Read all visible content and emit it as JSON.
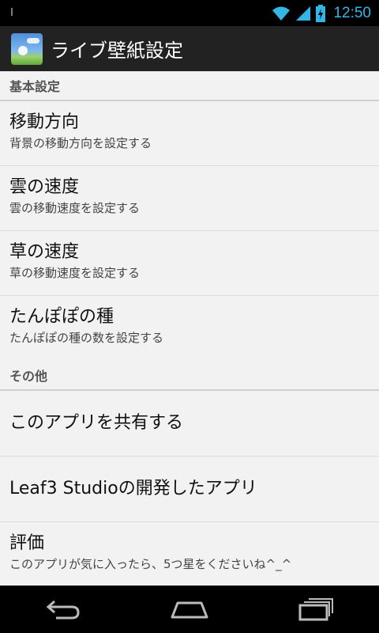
{
  "status_bar": {
    "time": "12:50",
    "accent_color": "#33b5e5"
  },
  "action_bar": {
    "title": "ライブ壁紙設定",
    "icon": "app-icon"
  },
  "categories": [
    {
      "label": "基本設定"
    },
    {
      "label": "その他"
    }
  ],
  "basic": [
    {
      "title": "移動方向",
      "summary": "背景の移動方向を設定する"
    },
    {
      "title": "雲の速度",
      "summary": "雲の移動速度を設定する"
    },
    {
      "title": "草の速度",
      "summary": "草の移動速度を設定する"
    },
    {
      "title": "たんぽぽの種",
      "summary": "たんぽぽの種の数を設定する"
    }
  ],
  "other": [
    {
      "title": "このアプリを共有する"
    },
    {
      "title": "Leaf3 Studioの開発したアプリ"
    },
    {
      "title": "評価",
      "summary": "このアプリが気に入ったら、5つ星をくださいね^_^"
    }
  ],
  "nav_bar": {
    "icons": [
      "back-icon",
      "home-icon",
      "recent-apps-icon"
    ]
  }
}
